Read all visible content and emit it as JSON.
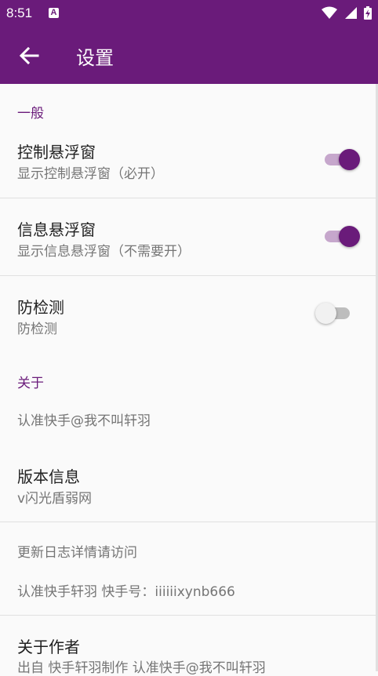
{
  "status_bar": {
    "time": "8:51",
    "notification_icon": "A"
  },
  "app_bar": {
    "title": "设置"
  },
  "sections": {
    "general": {
      "header": "一般",
      "floating_control": {
        "title": "控制悬浮窗",
        "subtitle": "显示控制悬浮窗（必开）",
        "enabled": true
      },
      "floating_info": {
        "title": "信息悬浮窗",
        "subtitle": "显示信息悬浮窗（不需要开）",
        "enabled": true
      },
      "anti_detect": {
        "title": "防检测",
        "subtitle": "防检测",
        "enabled": false
      }
    },
    "about": {
      "header": "关于",
      "recognize": "认准快手@我不叫轩羽",
      "version": {
        "title": "版本信息",
        "subtitle": "v闪光盾弱网"
      },
      "changelog": "更新日志详情请访问",
      "kuaishou_id": "认准快手轩羽 快手号：iiiiiixynb666",
      "author": {
        "title": "关于作者",
        "subtitle": "出自 快手轩羽制作 认准快手@我不叫轩羽"
      }
    }
  },
  "colors": {
    "primary": "#6a1b7a",
    "accent_track": "#c6a7cc"
  },
  "icons": [
    "back-arrow-icon",
    "wifi-icon",
    "signal-icon",
    "battery-icon"
  ]
}
